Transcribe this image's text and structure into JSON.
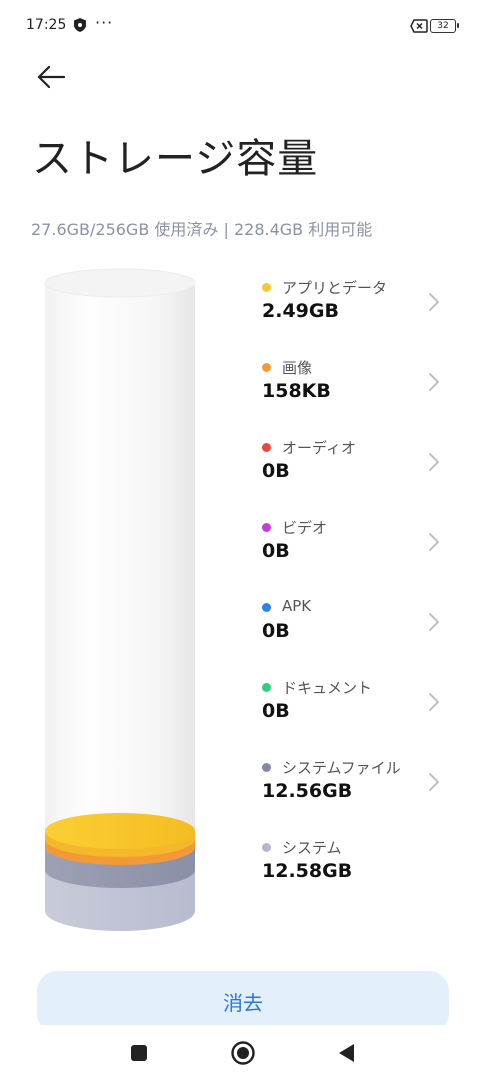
{
  "status": {
    "time": "17:25",
    "battery": "32",
    "icons": [
      "shield-icon",
      "more-dots-icon",
      "no-sim-icon",
      "battery-icon"
    ]
  },
  "header": {
    "back_icon": "arrow-left-icon",
    "title": "ストレージ容量",
    "summary": "27.6GB/256GB 使用済み | 228.4GB 利用可能"
  },
  "categories": [
    {
      "label": "アプリとデータ",
      "value": "2.49GB",
      "color": "#f9c72d",
      "chevron": true
    },
    {
      "label": "画像",
      "value": "158KB",
      "color": "#f59a34",
      "chevron": true
    },
    {
      "label": "オーディオ",
      "value": "0B",
      "color": "#e8483b",
      "chevron": true
    },
    {
      "label": "ビデオ",
      "value": "0B",
      "color": "#c53ad9",
      "chevron": true
    },
    {
      "label": "APK",
      "value": "0B",
      "color": "#2f80e8",
      "chevron": true
    },
    {
      "label": "ドキュメント",
      "value": "0B",
      "color": "#2fcf7f",
      "chevron": true
    },
    {
      "label": "システムファイル",
      "value": "12.56GB",
      "color": "#8088a4",
      "chevron": true
    },
    {
      "label": "システム",
      "value": "12.58GB",
      "color": "#b2b8cc",
      "chevron": false
    }
  ],
  "actions": {
    "clear_label": "消去"
  },
  "nav": {
    "icons": [
      "recents-square-icon",
      "home-circle-icon",
      "back-triangle-icon"
    ]
  },
  "colors": {
    "accent": "#2a78d6",
    "button_bg": "#e4effc",
    "summary_text": "#8a93a6"
  }
}
